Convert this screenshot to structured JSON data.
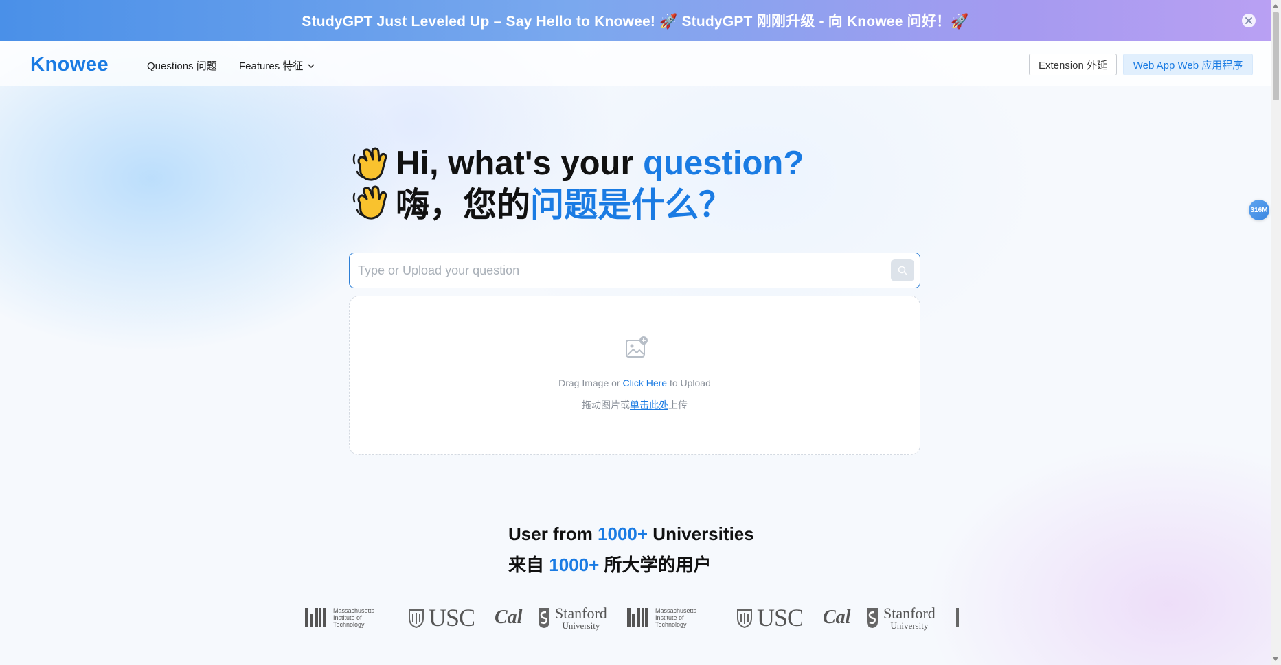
{
  "announcement": {
    "text": "StudyGPT Just Leveled Up – Say Hello to Knowee! 🚀 StudyGPT 刚刚升级 - 向 Knowee 问好！🚀",
    "close_icon": "close-icon"
  },
  "nav": {
    "logo": "Knowee",
    "questions": "Questions 问题",
    "features": "Features 特征",
    "extension": "Extension 外延",
    "webapp": "Web App Web 应用程序"
  },
  "badge": "316M",
  "hero": {
    "line1_prefix": "Hi, what's your ",
    "line1_accent": "question?",
    "line2_prefix": "嗨，您的",
    "line2_accent": "问题是什么？"
  },
  "search": {
    "placeholder": "Type or Upload your question"
  },
  "upload": {
    "line1_pre": "Drag Image or ",
    "line1_link": "Click Here",
    "line1_post": " to Upload",
    "line2_pre": "拖动图片或",
    "line2_link": "单击此处",
    "line2_post": "上传"
  },
  "universities": {
    "line1_pre": "User from ",
    "line1_accent": "1000+",
    "line1_post": " Universities",
    "line2_pre": "来自 ",
    "line2_accent": "1000+",
    "line2_post": " 所大学的用户",
    "logos": {
      "mit_1": "Massachusetts",
      "mit_2": "Institute of",
      "mit_3": "Technology",
      "usc": "USC",
      "cal": "Cal",
      "stanford": "Stanford",
      "stanford_sub": "University"
    }
  },
  "colors": {
    "accent": "#1a7be3",
    "banner_start": "#4a90e8",
    "banner_end": "#b9a0f3"
  }
}
